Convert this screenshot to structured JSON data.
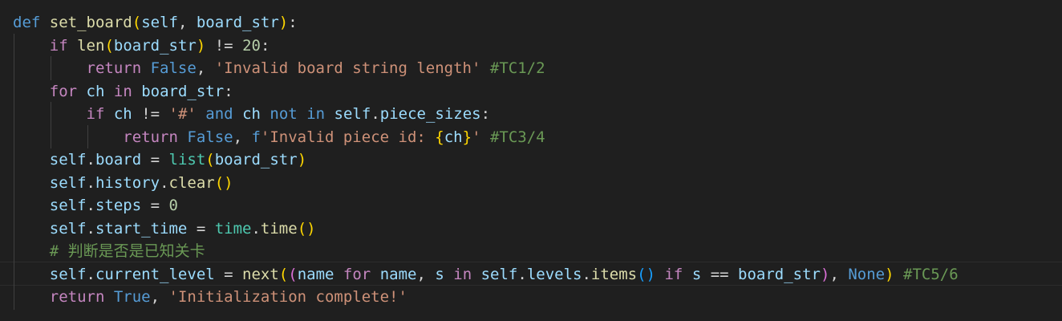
{
  "code": {
    "language": "python",
    "lines": [
      {
        "tokens": [
          {
            "t": "def",
            "c": "kw"
          },
          {
            "t": " ",
            "c": "op"
          },
          {
            "t": "set_board",
            "c": "fn"
          },
          {
            "t": "(",
            "c": "b1"
          },
          {
            "t": "self",
            "c": "var"
          },
          {
            "t": ", ",
            "c": "op"
          },
          {
            "t": "board_str",
            "c": "var"
          },
          {
            "t": ")",
            "c": "b1"
          },
          {
            "t": ":",
            "c": "op"
          }
        ]
      },
      {
        "tokens": [
          {
            "t": "    ",
            "c": "op"
          },
          {
            "t": "if",
            "c": "ctl"
          },
          {
            "t": " ",
            "c": "op"
          },
          {
            "t": "len",
            "c": "fn"
          },
          {
            "t": "(",
            "c": "b1"
          },
          {
            "t": "board_str",
            "c": "var"
          },
          {
            "t": ")",
            "c": "b1"
          },
          {
            "t": " != ",
            "c": "op"
          },
          {
            "t": "20",
            "c": "num"
          },
          {
            "t": ":",
            "c": "op"
          }
        ]
      },
      {
        "tokens": [
          {
            "t": "        ",
            "c": "op"
          },
          {
            "t": "return",
            "c": "ctl"
          },
          {
            "t": " ",
            "c": "op"
          },
          {
            "t": "False",
            "c": "kw"
          },
          {
            "t": ", ",
            "c": "op"
          },
          {
            "t": "'Invalid board string length'",
            "c": "str"
          },
          {
            "t": " ",
            "c": "op"
          },
          {
            "t": "#TC1/2",
            "c": "cmt"
          }
        ]
      },
      {
        "tokens": [
          {
            "t": "    ",
            "c": "op"
          },
          {
            "t": "for",
            "c": "ctl"
          },
          {
            "t": " ",
            "c": "op"
          },
          {
            "t": "ch",
            "c": "var"
          },
          {
            "t": " ",
            "c": "op"
          },
          {
            "t": "in",
            "c": "ctl"
          },
          {
            "t": " ",
            "c": "op"
          },
          {
            "t": "board_str",
            "c": "var"
          },
          {
            "t": ":",
            "c": "op"
          }
        ]
      },
      {
        "tokens": [
          {
            "t": "        ",
            "c": "op"
          },
          {
            "t": "if",
            "c": "ctl"
          },
          {
            "t": " ",
            "c": "op"
          },
          {
            "t": "ch",
            "c": "var"
          },
          {
            "t": " != ",
            "c": "op"
          },
          {
            "t": "'#'",
            "c": "str"
          },
          {
            "t": " ",
            "c": "op"
          },
          {
            "t": "and",
            "c": "kw"
          },
          {
            "t": " ",
            "c": "op"
          },
          {
            "t": "ch",
            "c": "var"
          },
          {
            "t": " ",
            "c": "op"
          },
          {
            "t": "not",
            "c": "kw"
          },
          {
            "t": " ",
            "c": "op"
          },
          {
            "t": "in",
            "c": "kw"
          },
          {
            "t": " ",
            "c": "op"
          },
          {
            "t": "self",
            "c": "var"
          },
          {
            "t": ".",
            "c": "op"
          },
          {
            "t": "piece_sizes",
            "c": "var"
          },
          {
            "t": ":",
            "c": "op"
          }
        ]
      },
      {
        "tokens": [
          {
            "t": "            ",
            "c": "op"
          },
          {
            "t": "return",
            "c": "ctl"
          },
          {
            "t": " ",
            "c": "op"
          },
          {
            "t": "False",
            "c": "kw"
          },
          {
            "t": ", ",
            "c": "op"
          },
          {
            "t": "f",
            "c": "kw"
          },
          {
            "t": "'Invalid piece id: ",
            "c": "str"
          },
          {
            "t": "{",
            "c": "b1"
          },
          {
            "t": "ch",
            "c": "var"
          },
          {
            "t": "}",
            "c": "b1"
          },
          {
            "t": "'",
            "c": "str"
          },
          {
            "t": " ",
            "c": "op"
          },
          {
            "t": "#TC3/4",
            "c": "cmt"
          }
        ]
      },
      {
        "tokens": [
          {
            "t": "    ",
            "c": "op"
          },
          {
            "t": "self",
            "c": "var"
          },
          {
            "t": ".",
            "c": "op"
          },
          {
            "t": "board",
            "c": "var"
          },
          {
            "t": " = ",
            "c": "op"
          },
          {
            "t": "list",
            "c": "cls"
          },
          {
            "t": "(",
            "c": "b1"
          },
          {
            "t": "board_str",
            "c": "var"
          },
          {
            "t": ")",
            "c": "b1"
          }
        ]
      },
      {
        "tokens": [
          {
            "t": "    ",
            "c": "op"
          },
          {
            "t": "self",
            "c": "var"
          },
          {
            "t": ".",
            "c": "op"
          },
          {
            "t": "history",
            "c": "var"
          },
          {
            "t": ".",
            "c": "op"
          },
          {
            "t": "clear",
            "c": "fn"
          },
          {
            "t": "()",
            "c": "b1"
          }
        ]
      },
      {
        "tokens": [
          {
            "t": "    ",
            "c": "op"
          },
          {
            "t": "self",
            "c": "var"
          },
          {
            "t": ".",
            "c": "op"
          },
          {
            "t": "steps",
            "c": "var"
          },
          {
            "t": " = ",
            "c": "op"
          },
          {
            "t": "0",
            "c": "num"
          }
        ]
      },
      {
        "tokens": [
          {
            "t": "    ",
            "c": "op"
          },
          {
            "t": "self",
            "c": "var"
          },
          {
            "t": ".",
            "c": "op"
          },
          {
            "t": "start_time",
            "c": "var"
          },
          {
            "t": " = ",
            "c": "op"
          },
          {
            "t": "time",
            "c": "cls"
          },
          {
            "t": ".",
            "c": "op"
          },
          {
            "t": "time",
            "c": "fn"
          },
          {
            "t": "()",
            "c": "b1"
          }
        ]
      },
      {
        "tokens": [
          {
            "t": "    ",
            "c": "op"
          },
          {
            "t": "# 判断是否是已知关卡",
            "c": "cmt"
          }
        ]
      },
      {
        "tokens": [
          {
            "t": "    ",
            "c": "op"
          },
          {
            "t": "self",
            "c": "var"
          },
          {
            "t": ".",
            "c": "op"
          },
          {
            "t": "current_level",
            "c": "var"
          },
          {
            "t": " = ",
            "c": "op"
          },
          {
            "t": "next",
            "c": "fn"
          },
          {
            "t": "(",
            "c": "b1"
          },
          {
            "t": "(",
            "c": "b2"
          },
          {
            "t": "name",
            "c": "var"
          },
          {
            "t": " ",
            "c": "op"
          },
          {
            "t": "for",
            "c": "ctl"
          },
          {
            "t": " ",
            "c": "op"
          },
          {
            "t": "name",
            "c": "var"
          },
          {
            "t": ", ",
            "c": "op"
          },
          {
            "t": "s",
            "c": "var"
          },
          {
            "t": " ",
            "c": "op"
          },
          {
            "t": "in",
            "c": "ctl"
          },
          {
            "t": " ",
            "c": "op"
          },
          {
            "t": "self",
            "c": "var"
          },
          {
            "t": ".",
            "c": "op"
          },
          {
            "t": "levels",
            "c": "var"
          },
          {
            "t": ".",
            "c": "op"
          },
          {
            "t": "items",
            "c": "fn"
          },
          {
            "t": "()",
            "c": "b3"
          },
          {
            "t": " ",
            "c": "op"
          },
          {
            "t": "if",
            "c": "ctl"
          },
          {
            "t": " ",
            "c": "op"
          },
          {
            "t": "s",
            "c": "var"
          },
          {
            "t": " == ",
            "c": "op"
          },
          {
            "t": "board_str",
            "c": "var"
          },
          {
            "t": ")",
            "c": "b2"
          },
          {
            "t": ", ",
            "c": "op"
          },
          {
            "t": "None",
            "c": "kw"
          },
          {
            "t": ")",
            "c": "b1"
          },
          {
            "t": " ",
            "c": "op"
          },
          {
            "t": "#TC5/6",
            "c": "cmt"
          }
        ]
      },
      {
        "tokens": [
          {
            "t": "    ",
            "c": "op"
          },
          {
            "t": "return",
            "c": "ctl"
          },
          {
            "t": " ",
            "c": "op"
          },
          {
            "t": "True",
            "c": "kw"
          },
          {
            "t": ", ",
            "c": "op"
          },
          {
            "t": "'Initialization complete!'",
            "c": "str"
          }
        ]
      }
    ]
  },
  "theme": {
    "background": "#1f1f1f",
    "keyword": "#569cd6",
    "control": "#c586c0",
    "function": "#dcdcaa",
    "variable": "#9cdcfe",
    "string": "#ce9178",
    "number": "#b5cea8",
    "comment": "#6a9955",
    "class": "#4ec9b0"
  }
}
